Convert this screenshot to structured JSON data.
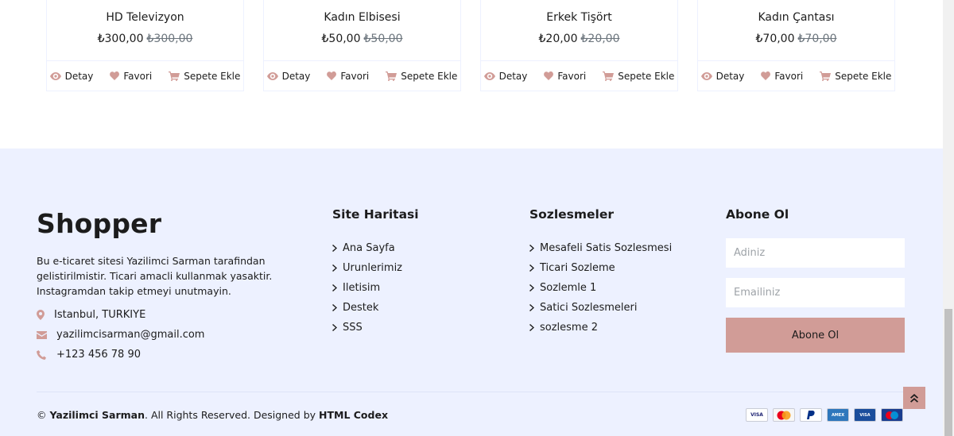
{
  "products": [
    {
      "name": "HD Televizyon",
      "price": "₺300,00",
      "old_price": "₺300,00"
    },
    {
      "name": "Kadın Elbisesi",
      "price": "₺50,00",
      "old_price": "₺50,00"
    },
    {
      "name": "Erkek Tişört",
      "price": "₺20,00",
      "old_price": "₺20,00"
    },
    {
      "name": "Kadın Çantası",
      "price": "₺70,00",
      "old_price": "₺70,00"
    }
  ],
  "product_actions": {
    "detail": "Detay",
    "favorite": "Favori",
    "add_to_cart": "Sepete Ekle"
  },
  "footer": {
    "brand": "Shopper",
    "about": "Bu e-ticaret sitesi Yazilimci Sarman tarafindan gelistirilmistir. Ticari amacli kullanmak yasaktir. Instagramdan takip etmeyi unutmayin.",
    "address": "Istanbul, TURKIYE",
    "email": "yazilimcisarman@gmail.com",
    "phone": "+123 456 78 90",
    "sitemap_title": "Site Haritasi",
    "sitemap_links": [
      "Ana Sayfa",
      "Urunlerimiz",
      "Iletisim",
      "Destek",
      "SSS"
    ],
    "contracts_title": "Sozlesmeler",
    "contracts_links": [
      "Mesafeli Satis Sozlesmesi",
      "Ticari Sozleme",
      "Sozlemle 1",
      "Satici Sozlesmeleri",
      "sozlesme 2"
    ],
    "subscribe_title": "Abone Ol",
    "name_placeholder": "Adiniz",
    "email_placeholder": "Emailiniz",
    "subscribe_button": "Abone Ol",
    "copyright_prefix": "© ",
    "copyright_owner": "Yazilimci Sarman",
    "copyright_middle": ". All Rights Reserved. Designed by ",
    "copyright_designer": "HTML Codex",
    "payment_methods": [
      "VISA",
      "MC",
      "PayPal",
      "AMEX",
      "VISA Electron",
      "Maestro"
    ]
  },
  "colors": {
    "accent": "#d19c97",
    "footer_bg": "#edf1ff",
    "text": "#1c1c1c"
  }
}
